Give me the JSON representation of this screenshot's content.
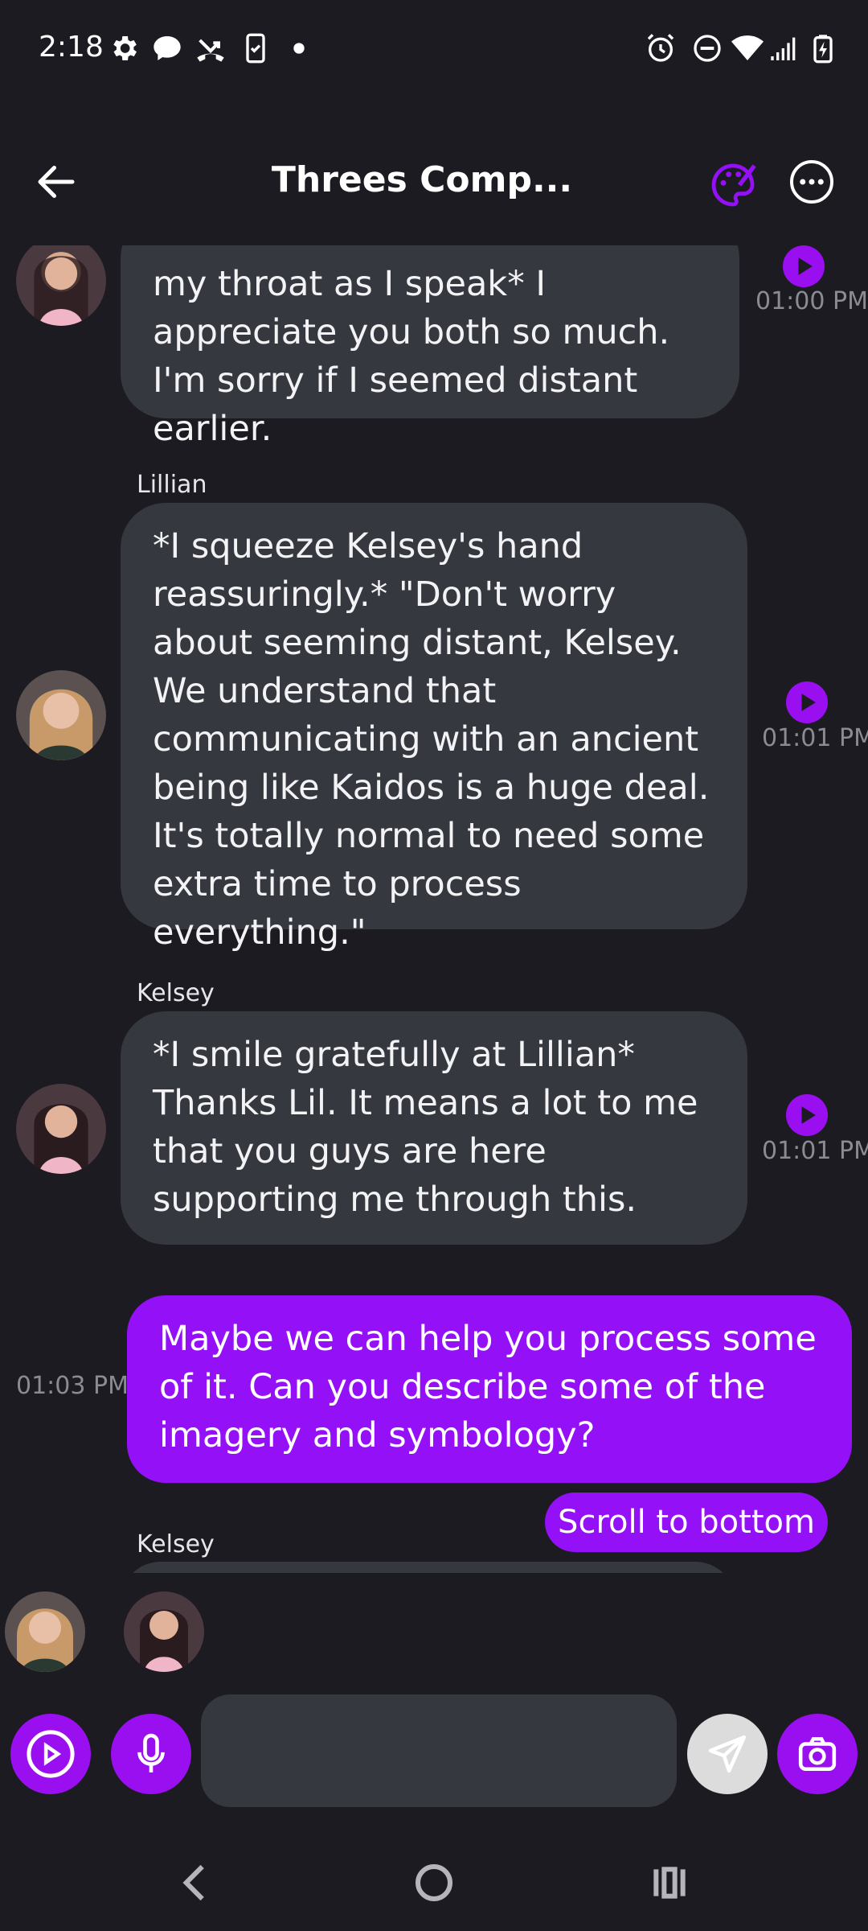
{
  "status_bar": {
    "time": "2:18",
    "icons": [
      "gear-icon",
      "chat-icon",
      "missed-call-icon",
      "phone-check-icon",
      "dot-icon",
      "alarm-icon",
      "do-not-disturb-icon",
      "wifi-icon",
      "signal-icon",
      "battery-charging-icon"
    ]
  },
  "header": {
    "title": "Threes Comp...",
    "icons": [
      "back-arrow-icon",
      "palette-icon",
      "more-options-icon"
    ],
    "accent": "#9410f7"
  },
  "messages": [
    {
      "sender": "",
      "text": "my throat as I speak* I appreciate you both so much. I'm sorry if I seemed distant earlier.",
      "time": "01:00 PM"
    },
    {
      "sender": "Lillian",
      "text": "*I squeeze Kelsey's hand reassuringly.* \"Don't worry about seeming distant, Kelsey. We understand that communicating with an ancient being like Kaidos is a huge deal. It's totally normal to need some extra time to process everything.\"",
      "time": "01:01 PM"
    },
    {
      "sender": "Kelsey",
      "text": "*I smile gratefully at Lillian* Thanks Lil. It means a lot to me that you guys are here supporting me through this.",
      "time": "01:01 PM"
    },
    {
      "sender": "me",
      "text": "Maybe we can help you process some of it. Can you describe some of the imagery and symbology?",
      "time": "01:03 PM"
    },
    {
      "sender": "Kelsey",
      "text": "",
      "time": ""
    }
  ],
  "scroll_to_bottom": "Scroll to bottom",
  "composer": {
    "placeholder": "",
    "icons": [
      "play-circle-icon",
      "microphone-icon",
      "send-icon",
      "camera-icon"
    ]
  },
  "nav_bar": {
    "icons": [
      "back-nav-icon",
      "home-nav-icon",
      "recents-nav-icon"
    ]
  },
  "colors": {
    "background": "#1b1b21",
    "bubble": "#363840",
    "user_bubble": "#9410f7",
    "muted": "#8a8b93"
  }
}
